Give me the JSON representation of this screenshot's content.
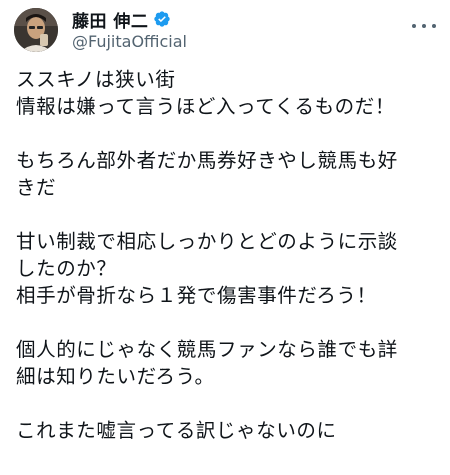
{
  "tweet": {
    "display_name": "藤田 伸二",
    "handle": "@FujitaOfficial",
    "verified": true,
    "lines": [
      "ススキノは狭い街",
      "情報は嫌って言うほど入ってくるものだ！",
      "",
      "もちろん部外者だか馬券好きやし競馬も好",
      "きだ",
      "",
      "甘い制裁で相応しっかりとどのように示談",
      "したのか？",
      "相手が骨折なら１発で傷害事件だろう！",
      "",
      "個人的にじゃなく競馬ファンなら誰でも詳",
      "細は知りたいだろう。",
      "",
      "これまた嘘言ってる訳じゃないのに"
    ]
  },
  "icons": {
    "avatar": "user-avatar",
    "verified": "verified-badge-icon",
    "more": "more-options-icon"
  },
  "colors": {
    "verified_blue": "#1d9bf0",
    "text": "#0f1419",
    "secondary": "#536471"
  }
}
